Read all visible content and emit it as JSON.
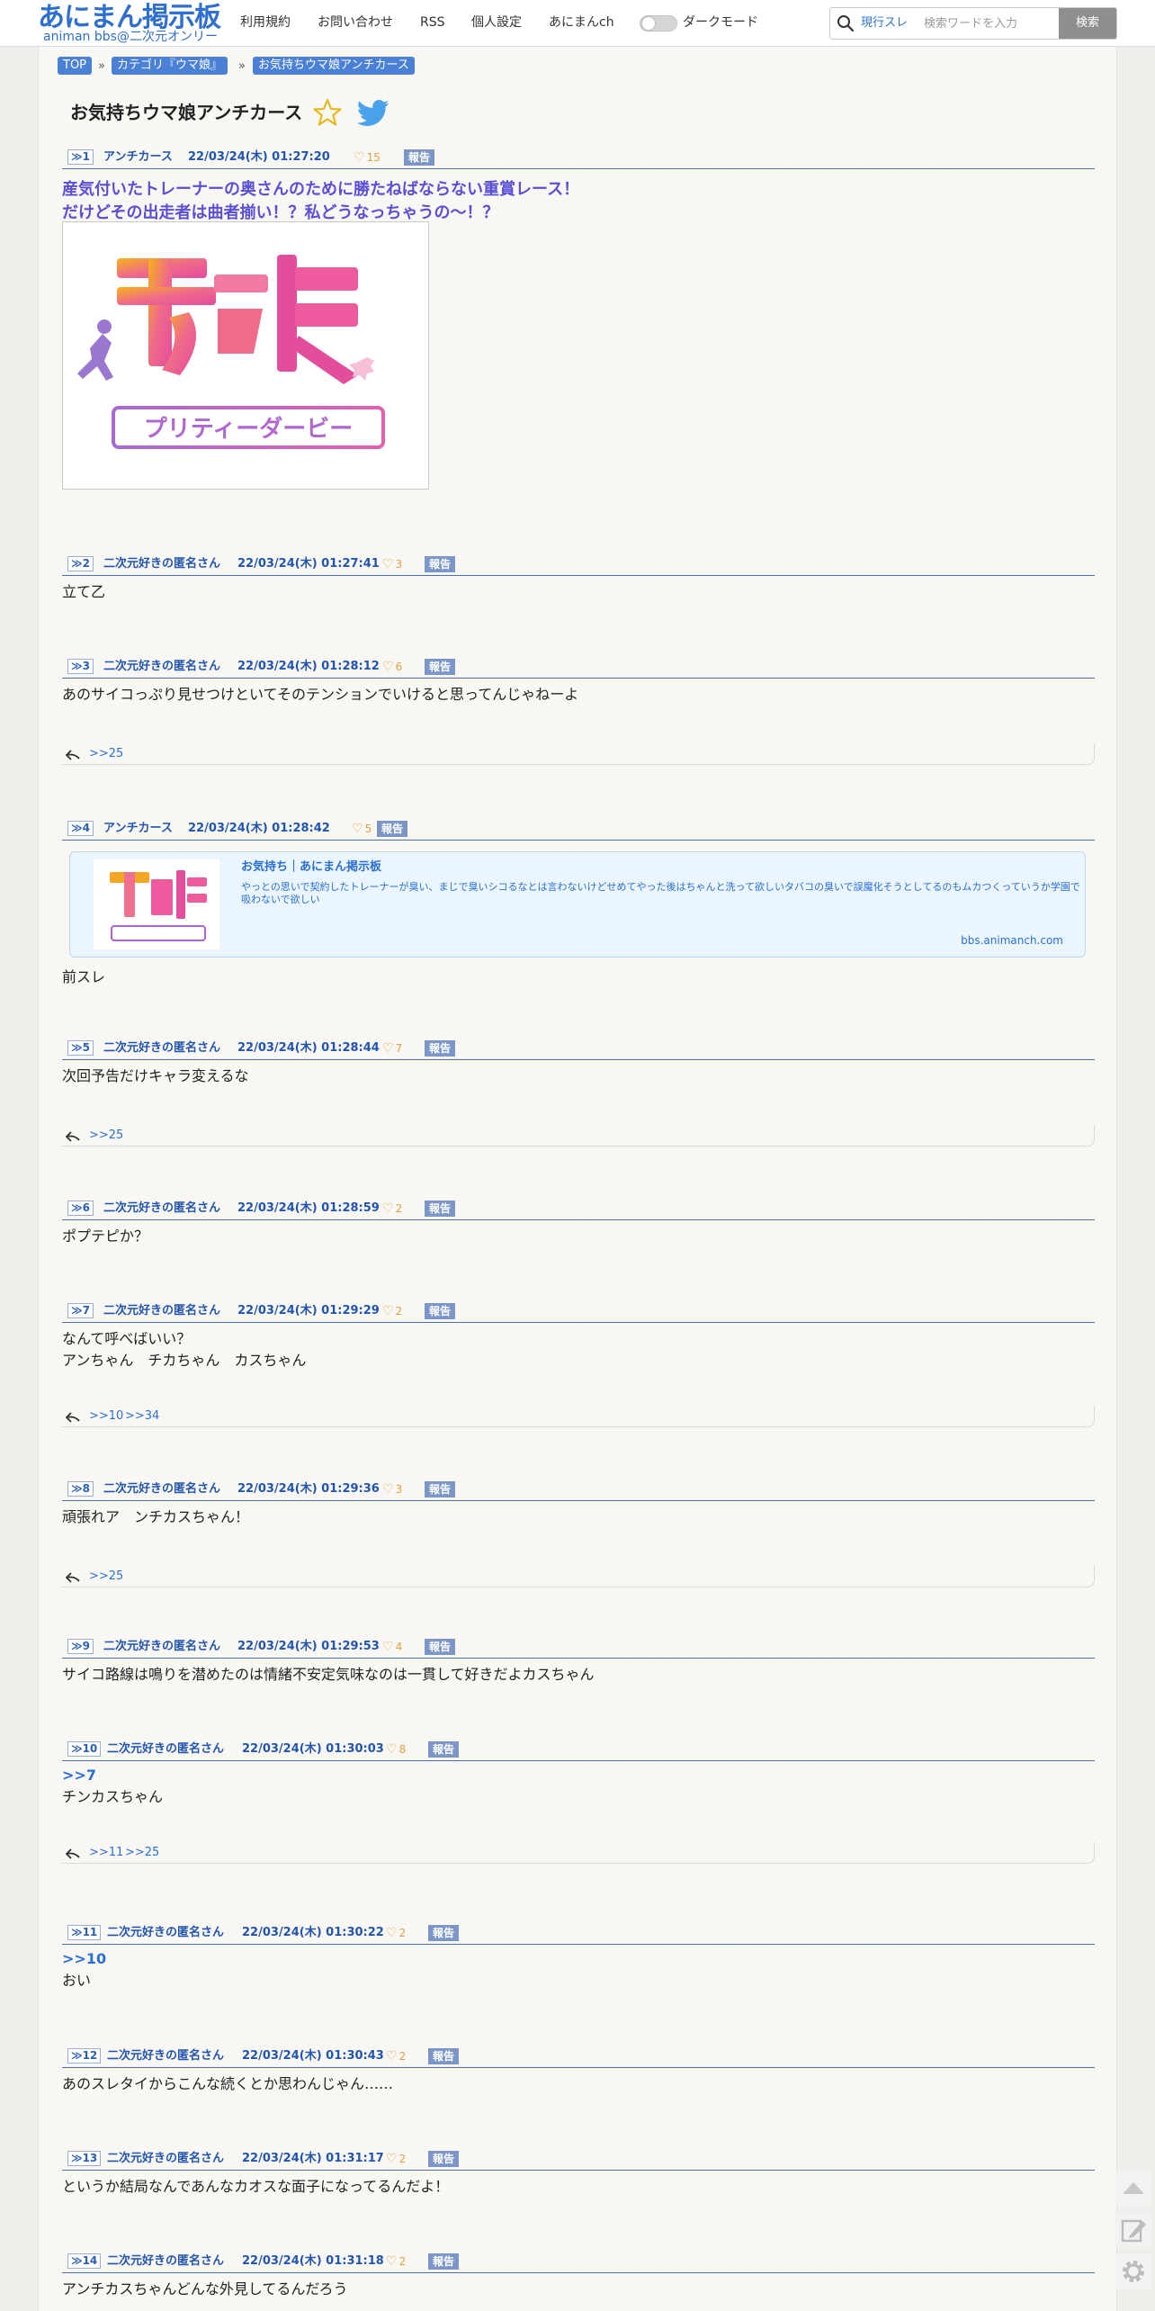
{
  "header": {
    "logo_main": "あにまん掲示板",
    "logo_sub": "animan bbs@二次元オンリー",
    "nav": [
      "利用規約",
      "お問い合わせ",
      "RSS",
      "個人設定",
      "あにまんch"
    ],
    "dark_mode_label": "ダークモード",
    "dark_mode_on": false,
    "search_scope": "現行スレ",
    "search_placeholder": "検索ワードを入力",
    "search_button": "検索"
  },
  "breadcrumb": [
    "TOP",
    "カテゴリ『ウマ娘』",
    "お気持ちウマ娘アンチカース"
  ],
  "thread": {
    "title": "お気持ちウマ娘アンチカース"
  },
  "labels": {
    "report": "報告",
    "heart": "♡"
  },
  "posts": [
    {
      "num": "1",
      "author": "アンチカース",
      "date": "22/03/24(木) 01:27:20",
      "likes": "15",
      "lines": [
        "産気付いたトレーナーの奥さんのために勝たねばならない重賞レース！",
        "だけどその出走者は曲者揃い！？私どうなっちゃうの〜！？"
      ],
      "image_alt": "ウマ娘 プリティーダービー"
    },
    {
      "num": "2",
      "author": "二次元好きの匿名さん",
      "date": "22/03/24(木) 01:27:41",
      "likes": "3",
      "lines": [
        "立て乙"
      ]
    },
    {
      "num": "3",
      "author": "二次元好きの匿名さん",
      "date": "22/03/24(木) 01:28:12",
      "likes": "6",
      "lines": [
        "あのサイコっぷり見せつけといてそのテンションでいけると思ってんじゃねーよ"
      ],
      "replies": [
        ">>25"
      ]
    },
    {
      "num": "4",
      "author": "アンチカース",
      "date": "22/03/24(木) 01:28:42",
      "likes": "5",
      "lines": [
        "前スレ"
      ],
      "card": {
        "title": "お気持ち｜あにまん掲示板",
        "desc": "やっとの思いで契約したトレーナーが臭い、まじで臭いシコるなとは言わないけどせめてやった後はちゃんと洗って欲しいタバコの臭いで誤魔化そうとしてるのもムカつくっていうか学園で吸わないで欲しい",
        "domain": "bbs.animanch.com"
      }
    },
    {
      "num": "5",
      "author": "二次元好きの匿名さん",
      "date": "22/03/24(木) 01:28:44",
      "likes": "7",
      "lines": [
        "次回予告だけキャラ変えるな"
      ],
      "replies": [
        ">>25"
      ]
    },
    {
      "num": "6",
      "author": "二次元好きの匿名さん",
      "date": "22/03/24(木) 01:28:59",
      "likes": "2",
      "lines": [
        "ポプテピか？"
      ]
    },
    {
      "num": "7",
      "author": "二次元好きの匿名さん",
      "date": "22/03/24(木) 01:29:29",
      "likes": "2",
      "lines": [
        "なんて呼べばいい？",
        "アンちゃん　チカちゃん　カスちゃん"
      ],
      "replies": [
        ">>10",
        ">>34"
      ]
    },
    {
      "num": "8",
      "author": "二次元好きの匿名さん",
      "date": "22/03/24(木) 01:29:36",
      "likes": "3",
      "lines": [
        "頑張れア　ンチカスちゃん！"
      ],
      "replies": [
        ">>25"
      ]
    },
    {
      "num": "9",
      "author": "二次元好きの匿名さん",
      "date": "22/03/24(木) 01:29:53",
      "likes": "4",
      "lines": [
        "サイコ路線は鳴りを潜めたのは情緒不安定気味なのは一貫して好きだよカスちゃん"
      ]
    },
    {
      "num": "10",
      "author": "二次元好きの匿名さん",
      "date": "22/03/24(木) 01:30:03",
      "likes": "8",
      "quote": ">>7",
      "lines": [
        "チンカスちゃん"
      ],
      "replies": [
        ">>11",
        ">>25"
      ]
    },
    {
      "num": "11",
      "author": "二次元好きの匿名さん",
      "date": "22/03/24(木) 01:30:22",
      "likes": "2",
      "quote": ">>10",
      "lines": [
        "おい"
      ]
    },
    {
      "num": "12",
      "author": "二次元好きの匿名さん",
      "date": "22/03/24(木) 01:30:43",
      "likes": "2",
      "lines": [
        "あのスレタイからこんな続くとか思わんじゃん……"
      ]
    },
    {
      "num": "13",
      "author": "二次元好きの匿名さん",
      "date": "22/03/24(木) 01:31:17",
      "likes": "2",
      "lines": [
        "というか結局なんであんなカオスな面子になってるんだよ！"
      ]
    },
    {
      "num": "14",
      "author": "二次元好きの匿名さん",
      "date": "22/03/24(木) 01:31:18",
      "likes": "2",
      "lines": [
        "アンチカスちゃんどんな外見してるんだろう"
      ]
    }
  ],
  "colors": {
    "accent": "#2f6fd0",
    "header_rule": "#4a6fb5",
    "heart": "#e0a040",
    "report_badge": "#7b96c7",
    "op_text": "#5a4fd6"
  }
}
